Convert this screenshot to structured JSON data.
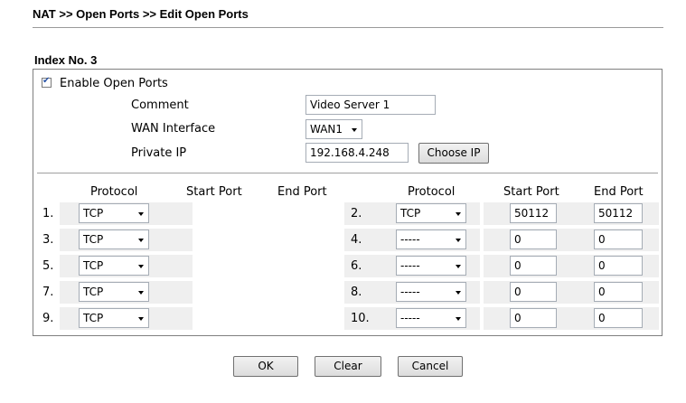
{
  "breadcrumb": "NAT >> Open Ports >> Edit Open Ports",
  "index_title": "Index No. 3",
  "enable": {
    "label": "Enable Open Ports",
    "checked": true
  },
  "comment": {
    "label": "Comment",
    "value": "Video Server 1"
  },
  "wan": {
    "label": "WAN Interface",
    "value": "WAN1"
  },
  "private_ip": {
    "label": "Private IP",
    "value": "192.168.4.248",
    "button": "Choose IP"
  },
  "columns": {
    "protocol": "Protocol",
    "start_port": "Start Port",
    "end_port": "End Port"
  },
  "entries": [
    {
      "num": "1.",
      "protocol": "TCP",
      "start": null,
      "end": null
    },
    {
      "num": "2.",
      "protocol": "TCP",
      "start": "50112",
      "end": "50112"
    },
    {
      "num": "3.",
      "protocol": "TCP",
      "start": null,
      "end": null
    },
    {
      "num": "4.",
      "protocol": "-----",
      "start": "0",
      "end": "0"
    },
    {
      "num": "5.",
      "protocol": "TCP",
      "start": null,
      "end": null
    },
    {
      "num": "6.",
      "protocol": "-----",
      "start": "0",
      "end": "0"
    },
    {
      "num": "7.",
      "protocol": "TCP",
      "start": null,
      "end": null
    },
    {
      "num": "8.",
      "protocol": "-----",
      "start": "0",
      "end": "0"
    },
    {
      "num": "9.",
      "protocol": "TCP",
      "start": null,
      "end": null
    },
    {
      "num": "10.",
      "protocol": "-----",
      "start": "0",
      "end": "0"
    }
  ],
  "buttons": {
    "ok": "OK",
    "clear": "Clear",
    "cancel": "Cancel"
  }
}
